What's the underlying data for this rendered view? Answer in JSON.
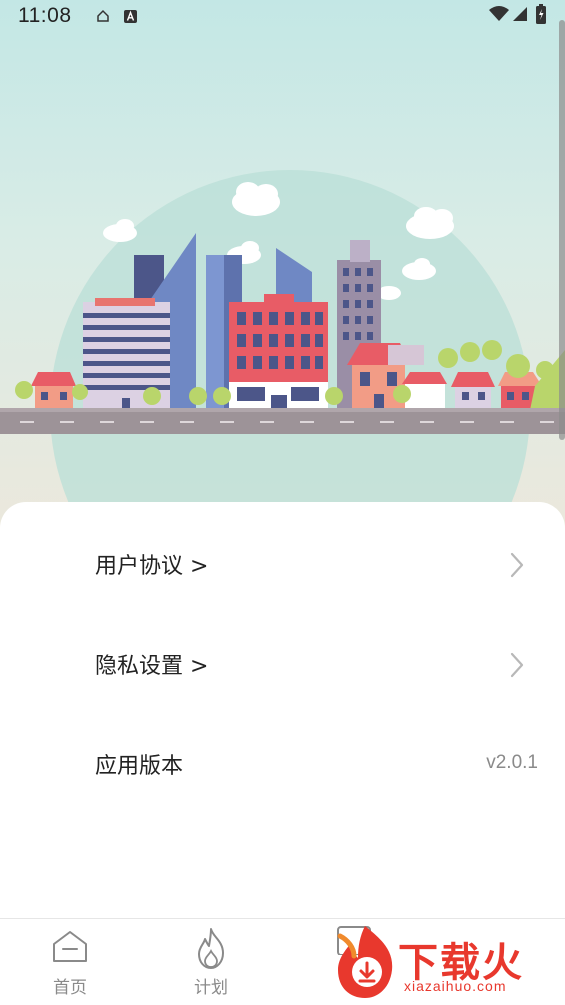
{
  "status_bar": {
    "time": "11:08"
  },
  "settings": {
    "items": [
      {
        "label": "用户协议 >"
      },
      {
        "label": "隐私设置 >"
      },
      {
        "label": "应用版本",
        "value": "v2.0.1"
      }
    ]
  },
  "tabbar": {
    "tabs": [
      {
        "label": "首页"
      },
      {
        "label": "计划"
      }
    ]
  },
  "watermark": {
    "text": "下载火",
    "subtext": "xiazaihuo.com"
  },
  "colors": {
    "accent": "#e8382d",
    "text_primary": "#222222",
    "text_secondary": "#8a8a8a"
  }
}
